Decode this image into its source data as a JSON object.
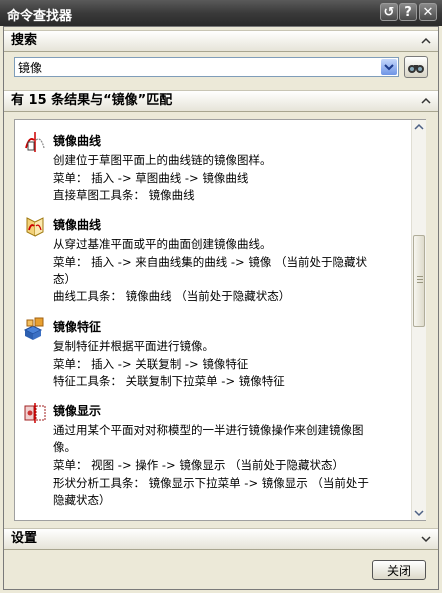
{
  "window": {
    "title": "命令查找器"
  },
  "search": {
    "header": "搜索",
    "value": "镜像"
  },
  "results": {
    "header": "有 15 条结果与“镜像”匹配",
    "items": [
      {
        "icon": "mirror-curve-sketch-icon",
        "name": "镜像曲线",
        "lines": [
          "创建位于草图平面上的曲线链的镜像图样。",
          "菜单： 插入 -> 草图曲线 -> 镜像曲线",
          "直接草图工具条： 镜像曲线"
        ]
      },
      {
        "icon": "mirror-curve-plane-icon",
        "name": "镜像曲线",
        "lines": [
          "从穿过基准平面或平的曲面创建镜像曲线。",
          "菜单： 插入 -> 来自曲线集的曲线 -> 镜像 （当前处于隐藏状",
          "态）",
          "曲线工具条： 镜像曲线 （当前处于隐藏状态）"
        ]
      },
      {
        "icon": "mirror-feature-icon",
        "name": "镜像特征",
        "lines": [
          "复制特征并根据平面进行镜像。",
          "菜单： 插入 -> 关联复制 -> 镜像特征",
          "特征工具条： 关联复制下拉菜单 -> 镜像特征"
        ]
      },
      {
        "icon": "mirror-display-icon",
        "name": "镜像显示",
        "lines": [
          "通过用某个平面对对称模型的一半进行镜像操作来创建镜像图",
          "像。",
          "菜单： 视图 -> 操作 -> 镜像显示 （当前处于隐藏状态）",
          "形状分析工具条： 镜像显示下拉菜单 -> 镜像显示 （当前处于",
          "隐藏状态）"
        ]
      }
    ]
  },
  "settings": {
    "header": "设置"
  },
  "footer": {
    "close_label": "关闭"
  }
}
